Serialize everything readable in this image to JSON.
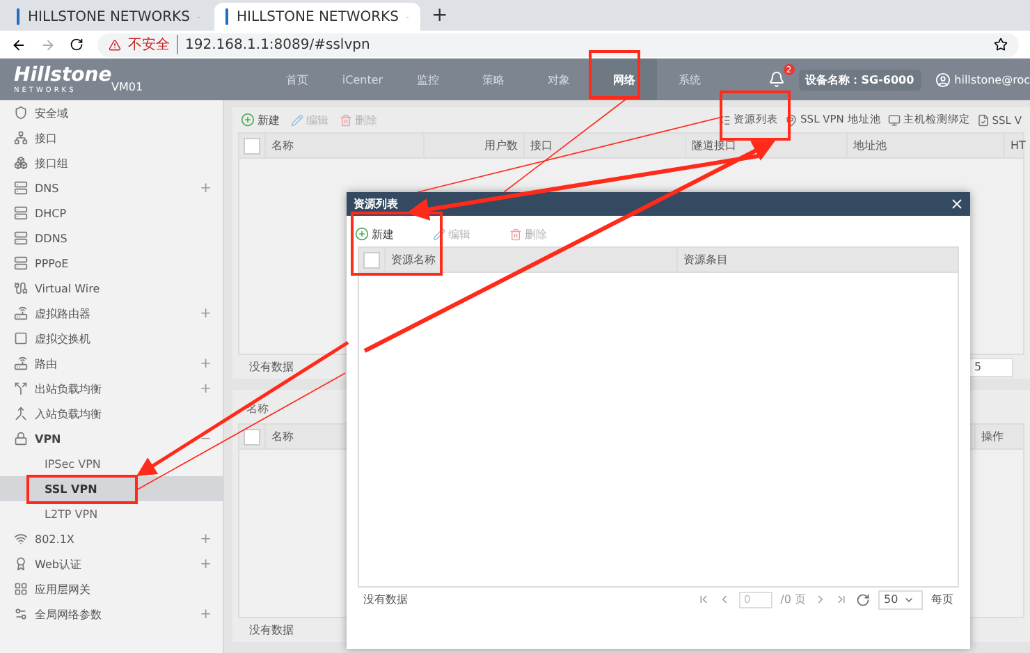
{
  "browser": {
    "tabs": [
      {
        "title": "HILLSTONE NETWORKS",
        "selected": false
      },
      {
        "title": "HILLSTONE NETWORKS",
        "selected": true
      }
    ],
    "new_tab": "+",
    "security_label": "不安全",
    "url": "192.168.1.1:8089/#sslvpn"
  },
  "header": {
    "logo": "Hillstone",
    "logo_sub": "NETWORKS",
    "device": "VM01",
    "nav": [
      {
        "label": "首页",
        "selected": false
      },
      {
        "label": "iCenter",
        "selected": false
      },
      {
        "label": "监控",
        "selected": false
      },
      {
        "label": "策略",
        "selected": false
      },
      {
        "label": "对象",
        "selected": false
      },
      {
        "label": "网络",
        "selected": true
      },
      {
        "label": "系统",
        "selected": false
      }
    ],
    "notifications": "2",
    "device_name": "设备名称：SG-6000",
    "user": "hillstone@roc"
  },
  "sidebar": {
    "items": [
      {
        "label": "安全域"
      },
      {
        "label": "接口"
      },
      {
        "label": "接口组"
      },
      {
        "label": "DNS",
        "toggle": "+"
      },
      {
        "label": "DHCP"
      },
      {
        "label": "DDNS"
      },
      {
        "label": "PPPoE"
      },
      {
        "label": "Virtual Wire"
      },
      {
        "label": "虚拟路由器",
        "toggle": "+"
      },
      {
        "label": "虚拟交换机"
      },
      {
        "label": "路由",
        "toggle": "+"
      },
      {
        "label": "出站负载均衡",
        "toggle": "+"
      },
      {
        "label": "入站负载均衡"
      },
      {
        "label": "VPN",
        "toggle": "−",
        "expanded": true,
        "children": [
          {
            "label": "IPSec VPN",
            "selected": false
          },
          {
            "label": "SSL VPN",
            "selected": true
          },
          {
            "label": "L2TP VPN",
            "selected": false
          }
        ]
      },
      {
        "label": "802.1X",
        "toggle": "+"
      },
      {
        "label": "Web认证",
        "toggle": "+"
      },
      {
        "label": "应用层网关"
      },
      {
        "label": "全局网络参数",
        "toggle": "+"
      }
    ]
  },
  "main": {
    "toolbar": [
      {
        "label": "新建",
        "kind": "add",
        "disabled": false
      },
      {
        "label": "编辑",
        "kind": "edit",
        "disabled": true
      },
      {
        "label": "删除",
        "kind": "delete",
        "disabled": true
      }
    ],
    "links": [
      "资源列表",
      "SSL VPN 地址池",
      "主机检测绑定",
      "SSL V"
    ],
    "table": {
      "all_checked": false,
      "columns": [
        "名称",
        "用户数",
        "接口",
        "隧道接口",
        "地址池",
        "HT"
      ],
      "footer": "没有数据",
      "page_size": "5"
    },
    "section": {
      "label": "名称",
      "all_checked": false,
      "columns": [
        "名称",
        "操作"
      ],
      "footer": "没有数据"
    }
  },
  "dialog": {
    "title": "资源列表",
    "toolbar": [
      {
        "label": "新建",
        "kind": "add",
        "disabled": false
      },
      {
        "label": "编辑",
        "kind": "edit",
        "disabled": true
      },
      {
        "label": "删除",
        "kind": "delete",
        "disabled": true
      }
    ],
    "all_checked": false,
    "columns": [
      "资源名称",
      "资源条目"
    ],
    "footer": "没有数据",
    "page": "0",
    "pages": "/0 页",
    "page_size": "50",
    "per_page": "每页"
  }
}
